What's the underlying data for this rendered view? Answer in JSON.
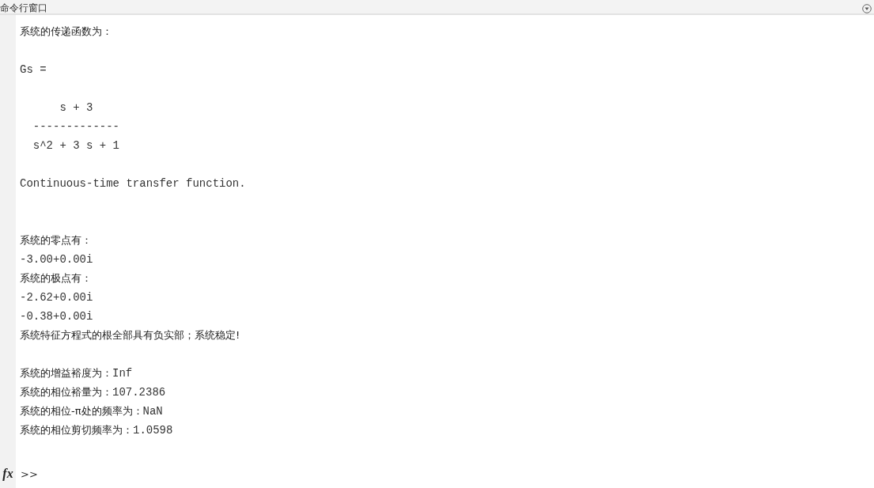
{
  "window": {
    "title": "命令行窗口"
  },
  "lines": [
    {
      "kind": "text",
      "label": "系统的传递函数为："
    },
    {
      "kind": "blank"
    },
    {
      "kind": "text",
      "value": "Gs ="
    },
    {
      "kind": "blank"
    },
    {
      "kind": "text",
      "value": "      s + 3"
    },
    {
      "kind": "text",
      "value": "  -------------"
    },
    {
      "kind": "text",
      "value": "  s^2 + 3 s + 1"
    },
    {
      "kind": "blank"
    },
    {
      "kind": "text",
      "value": "Continuous-time transfer function."
    },
    {
      "kind": "blank"
    },
    {
      "kind": "blank"
    },
    {
      "kind": "text",
      "label": "系统的零点有："
    },
    {
      "kind": "text",
      "value": "-3.00+0.00i"
    },
    {
      "kind": "text",
      "label": "系统的极点有："
    },
    {
      "kind": "text",
      "value": "-2.62+0.00i"
    },
    {
      "kind": "text",
      "value": "-0.38+0.00i"
    },
    {
      "kind": "text",
      "label": "系统特征方程式的根全部具有负实部；系统稳定!"
    },
    {
      "kind": "blank"
    },
    {
      "kind": "text",
      "label": "系统的增益裕度为：",
      "value": "Inf"
    },
    {
      "kind": "text",
      "label": "系统的相位裕量为：",
      "value": "107.2386"
    },
    {
      "kind": "text",
      "label": "系统的相位-π处的频率为：",
      "value": "NaN"
    },
    {
      "kind": "text",
      "label": "系统的相位剪切频率为：",
      "value": "1.0598"
    },
    {
      "kind": "blank"
    }
  ],
  "prompt": {
    "icon": "fx",
    "text": ">>"
  }
}
